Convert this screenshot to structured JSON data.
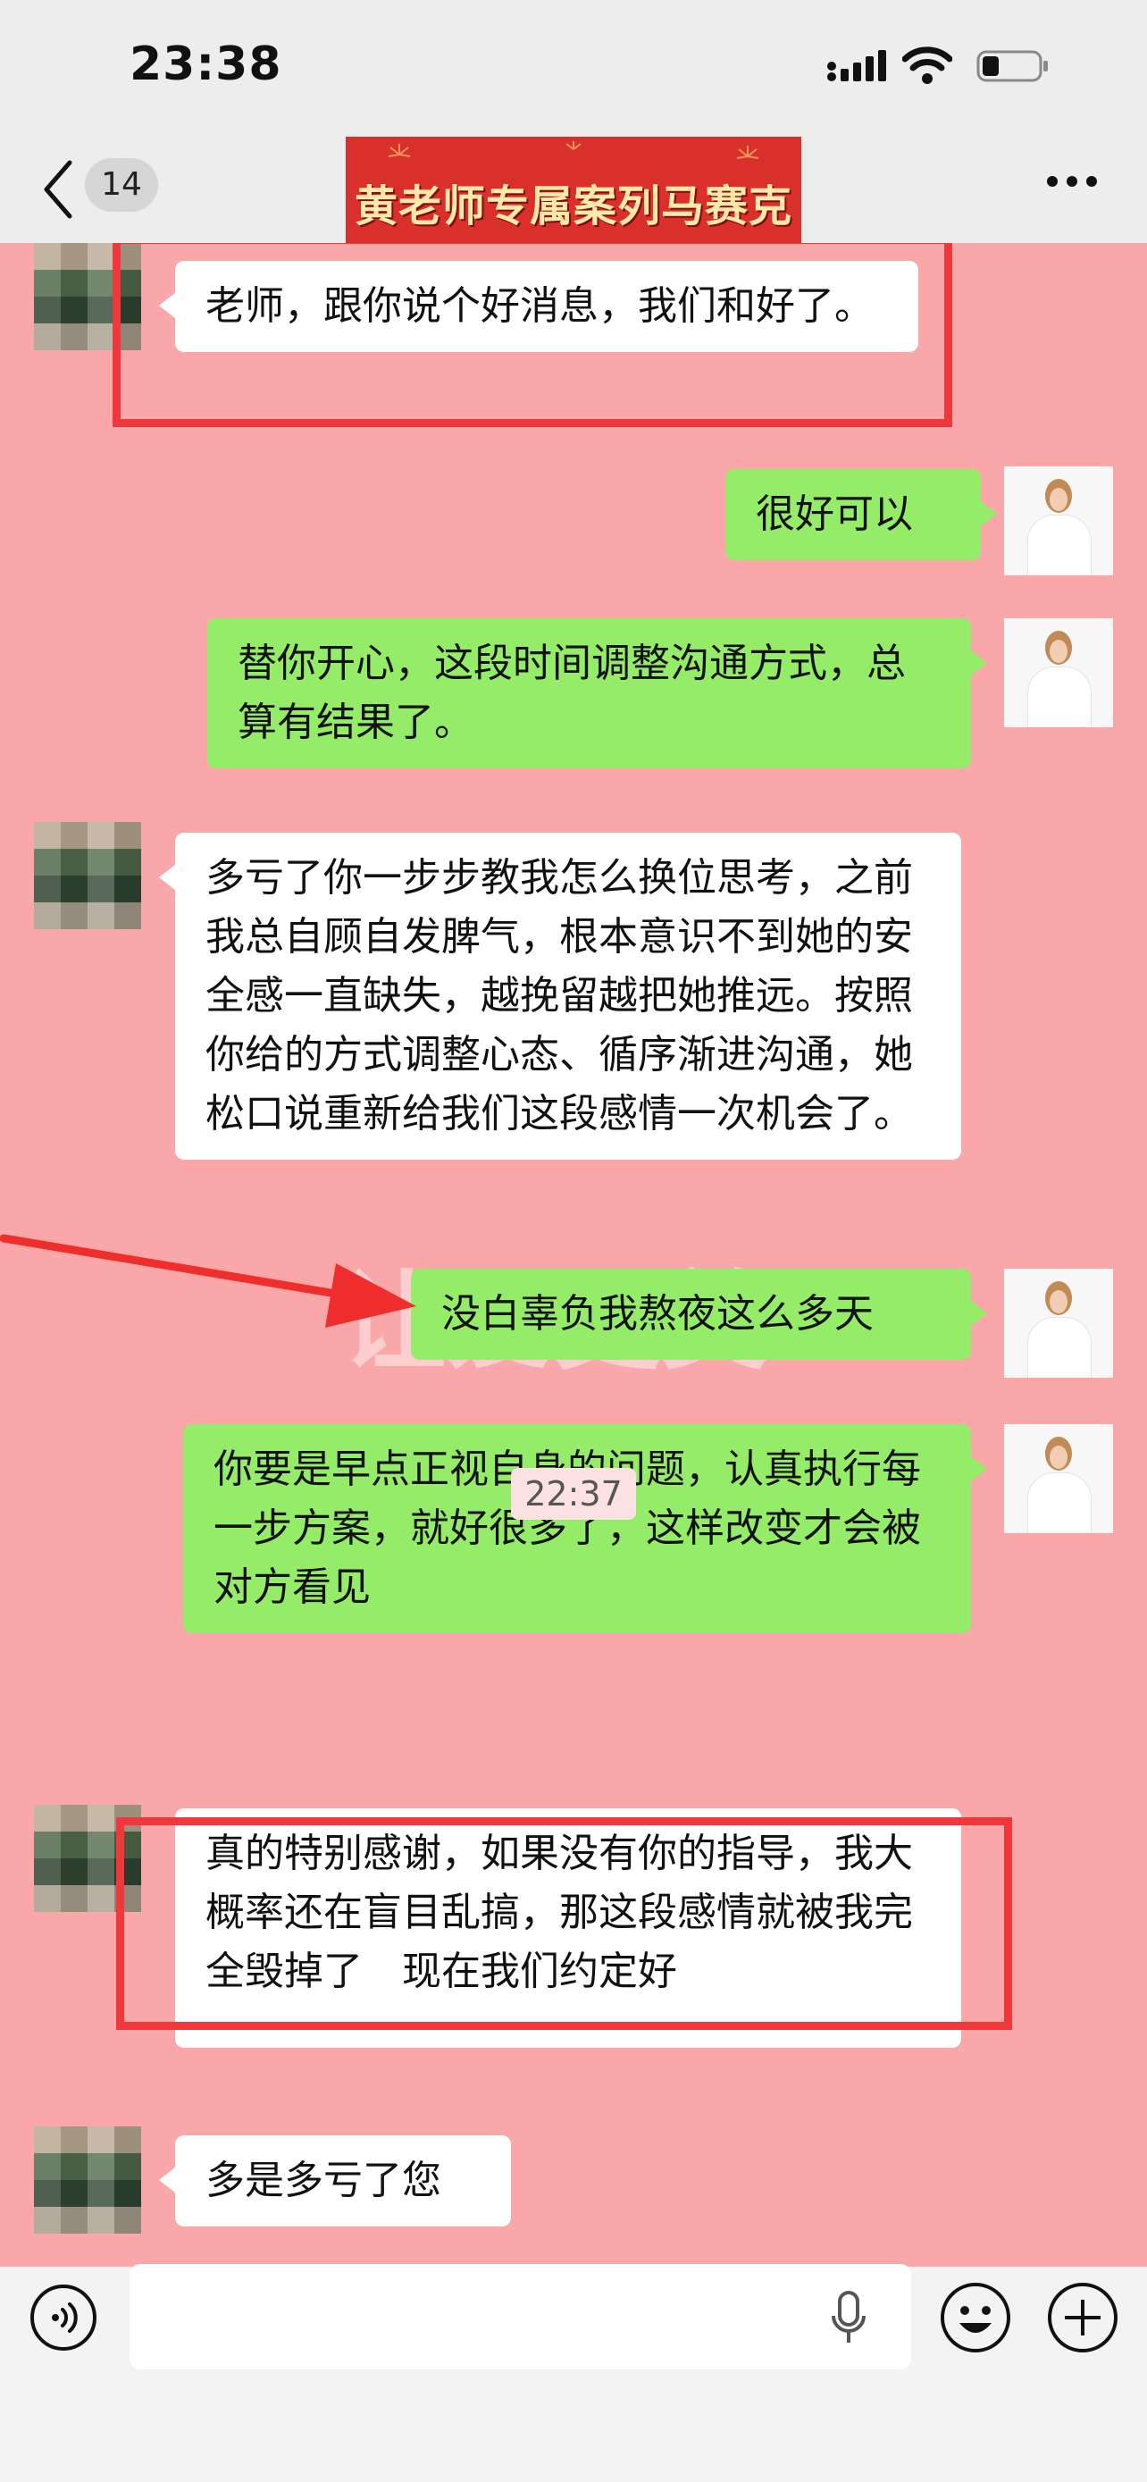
{
  "status_bar": {
    "time": "23:38"
  },
  "nav": {
    "unread_count": "14",
    "banner_title": "黄老师专属案列马赛克"
  },
  "messages": [
    {
      "side": "left",
      "text": "老师，跟你说个好消息，我们和好了。"
    },
    {
      "side": "right",
      "text": "很好可以"
    },
    {
      "side": "right",
      "text": "替你开心，这段时间调整沟通方式，总算有结果了。"
    },
    {
      "side": "left",
      "text": "多亏了你一步步教我怎么换位思考，之前我总自顾自发脾气，根本意识不到她的安全感一直缺失，越挽留越把她推远。按照你给的方式调整心态、循序渐进沟通，她松口说重新给我们这段感情一次机会了。"
    },
    {
      "side": "right",
      "text": "没白辜负我熬夜这么多天"
    },
    {
      "side": "right",
      "text": "你要是早点正视自身的问题，认真执行每一步方案，就好很多了，这样改变才会被对方看见"
    },
    {
      "side": "left",
      "text": "真的特别感谢，如果没有你的指导，我大概率还在盲目乱搞，那这段感情就被我完全毁掉了　现在我们约定好"
    },
    {
      "side": "left",
      "text": "多是多亏了您"
    }
  ],
  "timestamp": "22:37",
  "icons": {
    "back": "chevron-left-icon",
    "more": "more-dots-icon",
    "voice": "voice-mode-icon",
    "mic": "microphone-icon",
    "emoji": "emoji-icon",
    "plus": "plus-icon"
  },
  "colors": {
    "chat_background": "#f9a7a9",
    "sent_bubble": "#95ec69",
    "received_bubble": "#ffffff",
    "highlight_box": "#f0383c",
    "banner": "#d9302c"
  }
}
